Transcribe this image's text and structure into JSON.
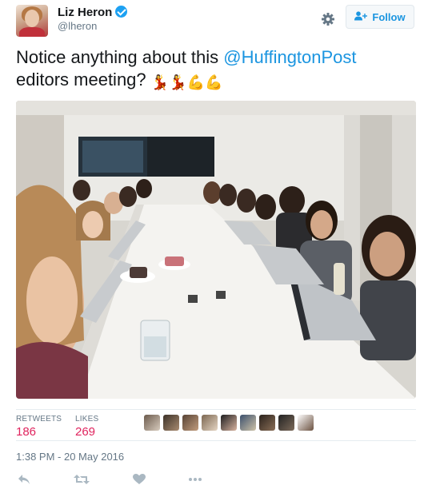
{
  "author": {
    "name": "Liz Heron",
    "handle": "@lheron"
  },
  "follow_label": "Follow",
  "tweet": {
    "text_before": "Notice anything about this ",
    "mention": "@HuffingtonPost",
    "text_after": " editors meeting? ",
    "emojis": [
      "💃",
      "💃",
      "💪",
      "💪"
    ]
  },
  "stats": {
    "retweets_label": "RETWEETS",
    "retweets_count": "186",
    "likes_label": "LIKES",
    "likes_count": "269"
  },
  "timestamp": "1:38 PM - 20 May 2016",
  "colors": {
    "accent": "#1b95e0",
    "like": "#e0245e",
    "muted": "#657786"
  },
  "icons": {
    "verified": "verified-badge-icon",
    "gear": "gear-icon",
    "follow": "add-user-icon",
    "reply": "reply-icon",
    "retweet": "retweet-icon",
    "like": "heart-icon",
    "more": "more-icon"
  }
}
